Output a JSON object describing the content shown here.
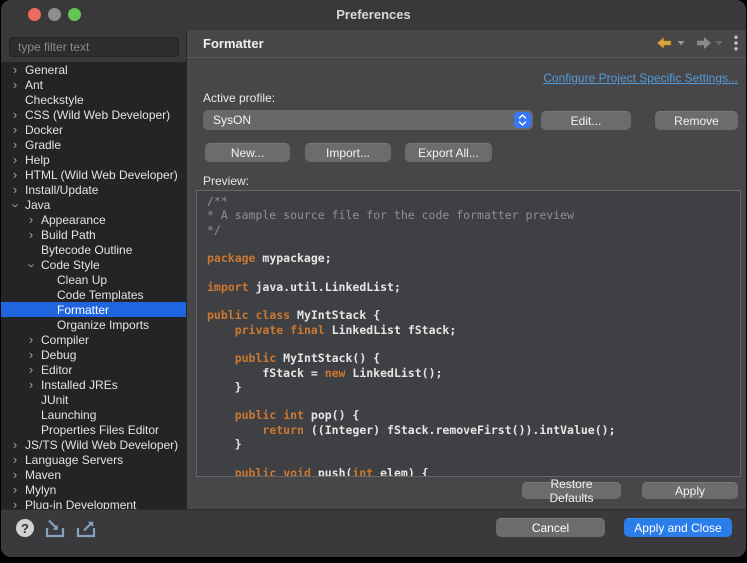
{
  "window": {
    "title": "Preferences"
  },
  "traffic_lights": {
    "close": "#ec6a5e",
    "minimize": "#8e8e90",
    "zoom": "#62c554"
  },
  "sidebar": {
    "filter_placeholder": "type filter text",
    "tree": [
      {
        "label": "General",
        "level": 0,
        "state": "collapsed",
        "selected": false
      },
      {
        "label": "Ant",
        "level": 0,
        "state": "collapsed",
        "selected": false
      },
      {
        "label": "Checkstyle",
        "level": 0,
        "state": "leaf",
        "selected": false
      },
      {
        "label": "CSS (Wild Web Developer)",
        "level": 0,
        "state": "collapsed",
        "selected": false
      },
      {
        "label": "Docker",
        "level": 0,
        "state": "collapsed",
        "selected": false
      },
      {
        "label": "Gradle",
        "level": 0,
        "state": "collapsed",
        "selected": false
      },
      {
        "label": "Help",
        "level": 0,
        "state": "collapsed",
        "selected": false
      },
      {
        "label": "HTML (Wild Web Developer)",
        "level": 0,
        "state": "collapsed",
        "selected": false
      },
      {
        "label": "Install/Update",
        "level": 0,
        "state": "collapsed",
        "selected": false
      },
      {
        "label": "Java",
        "level": 0,
        "state": "expanded",
        "selected": false
      },
      {
        "label": "Appearance",
        "level": 1,
        "state": "collapsed",
        "selected": false
      },
      {
        "label": "Build Path",
        "level": 1,
        "state": "collapsed",
        "selected": false
      },
      {
        "label": "Bytecode Outline",
        "level": 1,
        "state": "leaf",
        "selected": false
      },
      {
        "label": "Code Style",
        "level": 1,
        "state": "expanded",
        "selected": false
      },
      {
        "label": "Clean Up",
        "level": 2,
        "state": "leaf",
        "selected": false
      },
      {
        "label": "Code Templates",
        "level": 2,
        "state": "leaf",
        "selected": false
      },
      {
        "label": "Formatter",
        "level": 2,
        "state": "leaf",
        "selected": true
      },
      {
        "label": "Organize Imports",
        "level": 2,
        "state": "leaf",
        "selected": false
      },
      {
        "label": "Compiler",
        "level": 1,
        "state": "collapsed",
        "selected": false
      },
      {
        "label": "Debug",
        "level": 1,
        "state": "collapsed",
        "selected": false
      },
      {
        "label": "Editor",
        "level": 1,
        "state": "collapsed",
        "selected": false
      },
      {
        "label": "Installed JREs",
        "level": 1,
        "state": "collapsed",
        "selected": false
      },
      {
        "label": "JUnit",
        "level": 1,
        "state": "leaf",
        "selected": false
      },
      {
        "label": "Launching",
        "level": 1,
        "state": "leaf",
        "selected": false
      },
      {
        "label": "Properties Files Editor",
        "level": 1,
        "state": "leaf",
        "selected": false
      },
      {
        "label": "JS/TS (Wild Web Developer)",
        "level": 0,
        "state": "collapsed",
        "selected": false
      },
      {
        "label": "Language Servers",
        "level": 0,
        "state": "collapsed",
        "selected": false
      },
      {
        "label": "Maven",
        "level": 0,
        "state": "collapsed",
        "selected": false
      },
      {
        "label": "Mylyn",
        "level": 0,
        "state": "collapsed",
        "selected": false
      },
      {
        "label": "Plug-in Development",
        "level": 0,
        "state": "collapsed",
        "selected": false
      }
    ]
  },
  "header": {
    "title": "Formatter"
  },
  "panel": {
    "link": "Configure Project Specific Settings...",
    "active_profile_label": "Active profile:",
    "profile_select": {
      "value": "SysON"
    },
    "buttons": {
      "edit": "Edit...",
      "remove": "Remove",
      "new": "New...",
      "import": "Import...",
      "export_all": "Export All...",
      "restore_defaults": "Restore Defaults",
      "apply": "Apply"
    },
    "preview_label": "Preview:",
    "preview_code": [
      [
        {
          "c": "cm",
          "t": "/**"
        }
      ],
      [
        {
          "c": "cm",
          "t": "* A sample source file for the code formatter preview"
        }
      ],
      [
        {
          "c": "cm",
          "t": "*/"
        }
      ],
      [],
      [
        {
          "c": "kw",
          "t": "package"
        },
        {
          "c": "tx",
          "t": " mypackage;"
        }
      ],
      [],
      [
        {
          "c": "kw",
          "t": "import"
        },
        {
          "c": "tx",
          "t": " java.util.LinkedList;"
        }
      ],
      [],
      [
        {
          "c": "kw",
          "t": "public"
        },
        {
          "c": "tx",
          "t": " "
        },
        {
          "c": "kw",
          "t": "class"
        },
        {
          "c": "tx",
          "t": " MyIntStack {"
        }
      ],
      [
        {
          "c": "tx",
          "t": "    "
        },
        {
          "c": "kw",
          "t": "private"
        },
        {
          "c": "tx",
          "t": " "
        },
        {
          "c": "kw",
          "t": "final"
        },
        {
          "c": "tx",
          "t": " LinkedList fStack;"
        }
      ],
      [],
      [
        {
          "c": "tx",
          "t": "    "
        },
        {
          "c": "kw",
          "t": "public"
        },
        {
          "c": "tx",
          "t": " MyIntStack() {"
        }
      ],
      [
        {
          "c": "tx",
          "t": "        fStack = "
        },
        {
          "c": "kw",
          "t": "new"
        },
        {
          "c": "tx",
          "t": " LinkedList();"
        }
      ],
      [
        {
          "c": "tx",
          "t": "    }"
        }
      ],
      [],
      [
        {
          "c": "tx",
          "t": "    "
        },
        {
          "c": "kw",
          "t": "public"
        },
        {
          "c": "tx",
          "t": " "
        },
        {
          "c": "kw",
          "t": "int"
        },
        {
          "c": "tx",
          "t": " pop() {"
        }
      ],
      [
        {
          "c": "tx",
          "t": "        "
        },
        {
          "c": "kw",
          "t": "return"
        },
        {
          "c": "tx",
          "t": " ((Integer) fStack.removeFirst()).intValue();"
        }
      ],
      [
        {
          "c": "tx",
          "t": "    }"
        }
      ],
      [],
      [
        {
          "c": "tx",
          "t": "    "
        },
        {
          "c": "kw",
          "t": "public"
        },
        {
          "c": "tx",
          "t": " "
        },
        {
          "c": "kw",
          "t": "void"
        },
        {
          "c": "tx",
          "t": " push("
        },
        {
          "c": "kw",
          "t": "int"
        },
        {
          "c": "tx",
          "t": " elem) {"
        }
      ]
    ]
  },
  "footer": {
    "cancel": "Cancel",
    "apply_and_close": "Apply and Close",
    "help": "?"
  },
  "colors": {
    "selection_blue": "#2065e0",
    "accent_blue": "#2b7de9",
    "stepper_blue": "#3478f6",
    "link_blue": "#549bd5",
    "keyword_orange": "#cd7832",
    "comment_gray": "#8e9193",
    "back_arrow_gold": "#d8a23f"
  }
}
